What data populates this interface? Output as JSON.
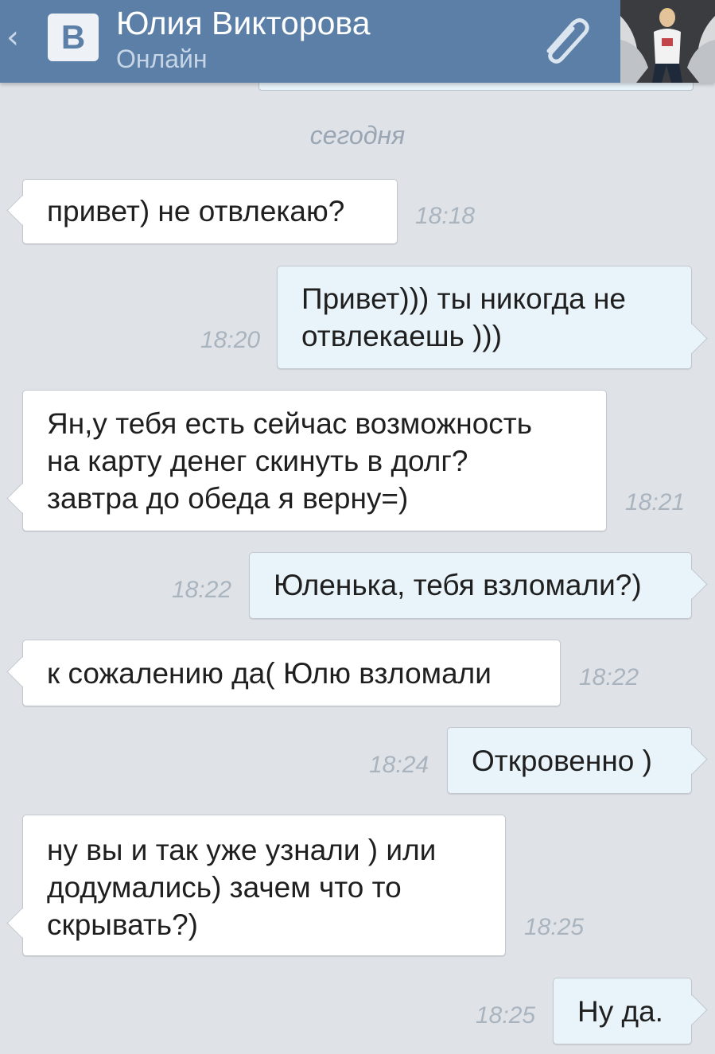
{
  "header": {
    "back_icon": "chevron-left-icon",
    "logo_letter": "В",
    "contact_name": "Юлия Викторова",
    "status": "Онлайн",
    "attach_icon": "paperclip-icon",
    "colors": {
      "header_bg": "#5b7fa6",
      "incoming_bg": "#ffffff",
      "outgoing_bg": "#e8f3fa"
    }
  },
  "date_separator": "сегодня",
  "messages": [
    {
      "direction": "in",
      "text": "привет) не отвлекаю?",
      "time": "18:18"
    },
    {
      "direction": "out",
      "text": "Привет))) ты никогда не\nотвлекаешь )))",
      "time": "18:20"
    },
    {
      "direction": "in",
      "text": "Ян,у тебя есть сейчас возможность\nна карту денег скинуть в долг?\nзавтра до обеда я верну=)",
      "time": "18:21"
    },
    {
      "direction": "out",
      "text": "Юленька, тебя взломали?)",
      "time": "18:22"
    },
    {
      "direction": "in",
      "text": "к сожалению да( Юлю взломали",
      "time": "18:22"
    },
    {
      "direction": "out",
      "text": "Откровенно )",
      "time": "18:24"
    },
    {
      "direction": "in",
      "text": "ну вы и так уже узнали ) или\nдодумались) зачем что то\nскрывать?)",
      "time": "18:25"
    },
    {
      "direction": "out",
      "text": "Ну да.",
      "time": "18:25"
    }
  ]
}
